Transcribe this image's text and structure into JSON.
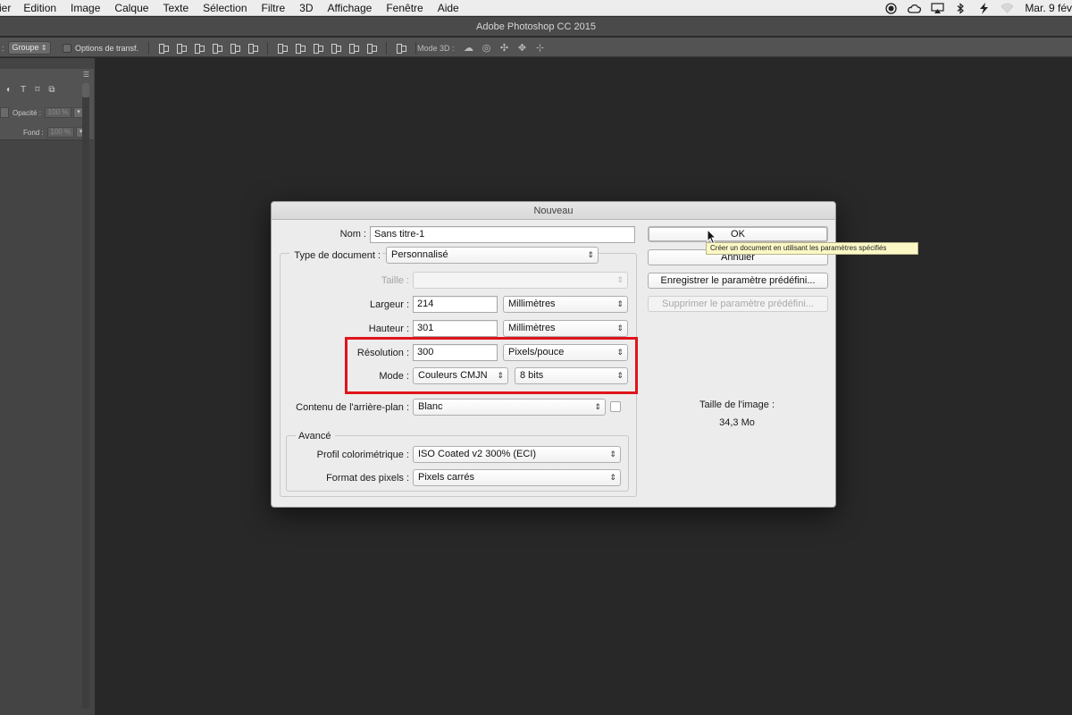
{
  "menubar": {
    "items": [
      "ier",
      "Edition",
      "Image",
      "Calque",
      "Texte",
      "Sélection",
      "Filtre",
      "3D",
      "Affichage",
      "Fenêtre",
      "Aide"
    ],
    "clock": "Mar. 9 fév",
    "status_icons": [
      "record-icon",
      "creative-cloud-icon",
      "airplay-icon",
      "bluetooth-icon",
      "flash-icon",
      "wifi-icon"
    ]
  },
  "app": {
    "title": "Adobe Photoshop CC 2015"
  },
  "optionsbar": {
    "group_select": "Groupe",
    "transform_label": "Options de transf.",
    "mode3d_label": "Mode 3D :"
  },
  "layers_panel": {
    "opacity_label": "Opacité :",
    "opacity_value": "100 %",
    "fill_label": "Fond :",
    "fill_value": "100 %"
  },
  "dialog": {
    "title": "Nouveau",
    "name_label": "Nom :",
    "name_value": "Sans titre-1",
    "doctype_label": "Type de document :",
    "doctype_value": "Personnalisé",
    "size_label": "Taille :",
    "size_value": "",
    "width_label": "Largeur :",
    "width_value": "214",
    "width_unit": "Millimètres",
    "height_label": "Hauteur :",
    "height_value": "301",
    "height_unit": "Millimètres",
    "resolution_label": "Résolution :",
    "resolution_value": "300",
    "resolution_unit": "Pixels/pouce",
    "mode_label": "Mode :",
    "mode_value": "Couleurs CMJN",
    "bits_value": "8 bits",
    "background_label": "Contenu de l'arrière-plan :",
    "background_value": "Blanc",
    "advanced_label": "Avancé",
    "profile_label": "Profil colorimétrique :",
    "profile_value": "ISO Coated v2 300% (ECI)",
    "pixel_format_label": "Format des pixels :",
    "pixel_format_value": "Pixels carrés",
    "ok_label": "OK",
    "cancel_label": "Annuler",
    "save_preset_label": "Enregistrer le paramètre prédéfini...",
    "delete_preset_label": "Supprimer le paramètre prédéfini...",
    "image_size_label": "Taille de l'image :",
    "image_size_value": "34,3 Mo",
    "tooltip": "Créer un document en utilisant les paramètres spécifiés"
  },
  "colors": {
    "highlight": "#e0141b",
    "workspace": "#282828",
    "dialog_bg": "#ececec"
  }
}
